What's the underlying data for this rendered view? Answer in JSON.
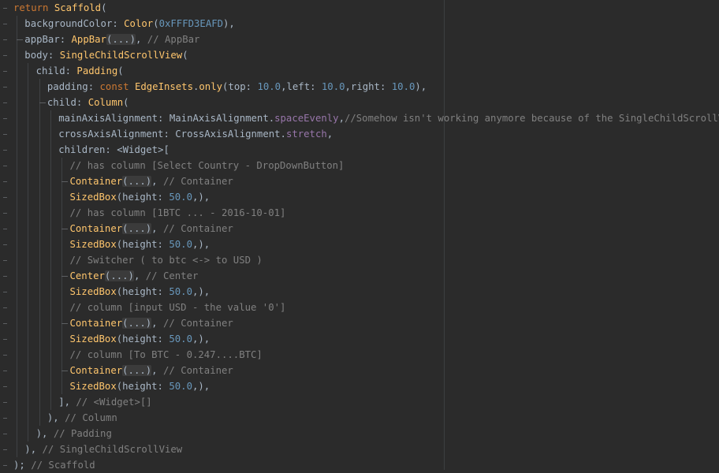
{
  "editor": {
    "lines": [
      {
        "indent": 1,
        "tokens": [
          {
            "t": "return ",
            "c": "kw"
          },
          {
            "t": "Scaffold",
            "c": "cls"
          },
          {
            "t": "(",
            "c": "plain"
          }
        ]
      },
      {
        "indent": 2,
        "tokens": [
          {
            "t": "backgroundColor: ",
            "c": "plain"
          },
          {
            "t": "Color",
            "c": "cls"
          },
          {
            "t": "(",
            "c": "plain"
          },
          {
            "t": "0xFFFD3EAFD",
            "c": "num"
          },
          {
            "t": "),",
            "c": "plain"
          }
        ]
      },
      {
        "indent": 2,
        "branch": true,
        "tokens": [
          {
            "t": "appBar: ",
            "c": "plain"
          },
          {
            "t": "AppBar",
            "c": "cls"
          },
          {
            "t": "(...)",
            "c": "fold"
          },
          {
            "t": ", ",
            "c": "plain"
          },
          {
            "t": "// AppBar",
            "c": "cmt"
          }
        ]
      },
      {
        "indent": 2,
        "tokens": [
          {
            "t": "body: ",
            "c": "plain"
          },
          {
            "t": "SingleChildScrollView",
            "c": "cls"
          },
          {
            "t": "(",
            "c": "plain"
          }
        ]
      },
      {
        "indent": 3,
        "tokens": [
          {
            "t": "child: ",
            "c": "plain"
          },
          {
            "t": "Padding",
            "c": "cls"
          },
          {
            "t": "(",
            "c": "plain"
          }
        ]
      },
      {
        "indent": 4,
        "tokens": [
          {
            "t": "padding: ",
            "c": "plain"
          },
          {
            "t": "const ",
            "c": "kw"
          },
          {
            "t": "EdgeInsets",
            "c": "cls"
          },
          {
            "t": ".",
            "c": "plain"
          },
          {
            "t": "only",
            "c": "fn"
          },
          {
            "t": "(top: ",
            "c": "plain"
          },
          {
            "t": "10.0",
            "c": "num"
          },
          {
            "t": ",left: ",
            "c": "plain"
          },
          {
            "t": "10.0",
            "c": "num"
          },
          {
            "t": ",right: ",
            "c": "plain"
          },
          {
            "t": "10.0",
            "c": "num"
          },
          {
            "t": "),",
            "c": "plain"
          }
        ]
      },
      {
        "indent": 4,
        "branch": true,
        "tokens": [
          {
            "t": "child: ",
            "c": "plain"
          },
          {
            "t": "Column",
            "c": "cls"
          },
          {
            "t": "(",
            "c": "plain"
          }
        ]
      },
      {
        "indent": 5,
        "tokens": [
          {
            "t": "mainAxisAlignment: ",
            "c": "plain"
          },
          {
            "t": "MainAxisAlignment",
            "c": "plain"
          },
          {
            "t": ".",
            "c": "plain"
          },
          {
            "t": "spaceEvenly",
            "c": "prop"
          },
          {
            "t": ",",
            "c": "plain"
          },
          {
            "t": "//Somehow isn't working anymore because of the SingleChildScrollView",
            "c": "cmt"
          }
        ]
      },
      {
        "indent": 5,
        "tokens": [
          {
            "t": "crossAxisAlignment: ",
            "c": "plain"
          },
          {
            "t": "CrossAxisAlignment",
            "c": "plain"
          },
          {
            "t": ".",
            "c": "plain"
          },
          {
            "t": "stretch",
            "c": "prop"
          },
          {
            "t": ",",
            "c": "plain"
          }
        ]
      },
      {
        "indent": 5,
        "tokens": [
          {
            "t": "children: ",
            "c": "plain"
          },
          {
            "t": "<Widget>[",
            "c": "plain"
          }
        ]
      },
      {
        "indent": 6,
        "tokens": [
          {
            "t": "// has column [Select Country - DropDownButton]",
            "c": "cmt"
          }
        ]
      },
      {
        "indent": 6,
        "branch": true,
        "tokens": [
          {
            "t": "Container",
            "c": "cls"
          },
          {
            "t": "(...)",
            "c": "fold"
          },
          {
            "t": ", ",
            "c": "plain"
          },
          {
            "t": "// Container",
            "c": "cmt"
          }
        ]
      },
      {
        "indent": 6,
        "tokens": [
          {
            "t": "SizedBox",
            "c": "cls"
          },
          {
            "t": "(height: ",
            "c": "plain"
          },
          {
            "t": "50.0",
            "c": "num"
          },
          {
            "t": ",),",
            "c": "plain"
          }
        ]
      },
      {
        "indent": 6,
        "tokens": [
          {
            "t": "// has column [1BTC ... - 2016-10-01]",
            "c": "cmt"
          }
        ]
      },
      {
        "indent": 6,
        "branch": true,
        "tokens": [
          {
            "t": "Container",
            "c": "cls"
          },
          {
            "t": "(...)",
            "c": "fold"
          },
          {
            "t": ", ",
            "c": "plain"
          },
          {
            "t": "// Container",
            "c": "cmt"
          }
        ]
      },
      {
        "indent": 6,
        "tokens": [
          {
            "t": "SizedBox",
            "c": "cls"
          },
          {
            "t": "(height: ",
            "c": "plain"
          },
          {
            "t": "50.0",
            "c": "num"
          },
          {
            "t": ",),",
            "c": "plain"
          }
        ]
      },
      {
        "indent": 6,
        "tokens": [
          {
            "t": "// Switcher ( to btc <-> to USD )",
            "c": "cmt"
          }
        ]
      },
      {
        "indent": 6,
        "branch": true,
        "tokens": [
          {
            "t": "Center",
            "c": "cls"
          },
          {
            "t": "(...)",
            "c": "fold"
          },
          {
            "t": ", ",
            "c": "plain"
          },
          {
            "t": "// Center",
            "c": "cmt"
          }
        ]
      },
      {
        "indent": 6,
        "tokens": [
          {
            "t": "SizedBox",
            "c": "cls"
          },
          {
            "t": "(height: ",
            "c": "plain"
          },
          {
            "t": "50.0",
            "c": "num"
          },
          {
            "t": ",),",
            "c": "plain"
          }
        ]
      },
      {
        "indent": 6,
        "tokens": [
          {
            "t": "// column [input USD - the value '0']",
            "c": "cmt"
          }
        ]
      },
      {
        "indent": 6,
        "branch": true,
        "tokens": [
          {
            "t": "Container",
            "c": "cls"
          },
          {
            "t": "(...)",
            "c": "fold"
          },
          {
            "t": ", ",
            "c": "plain"
          },
          {
            "t": "// Container",
            "c": "cmt"
          }
        ]
      },
      {
        "indent": 6,
        "tokens": [
          {
            "t": "SizedBox",
            "c": "cls"
          },
          {
            "t": "(height: ",
            "c": "plain"
          },
          {
            "t": "50.0",
            "c": "num"
          },
          {
            "t": ",),",
            "c": "plain"
          }
        ]
      },
      {
        "indent": 6,
        "tokens": [
          {
            "t": "// column [To BTC - 0.247....BTC]",
            "c": "cmt"
          }
        ]
      },
      {
        "indent": 6,
        "branch": true,
        "tokens": [
          {
            "t": "Container",
            "c": "cls"
          },
          {
            "t": "(...)",
            "c": "fold"
          },
          {
            "t": ", ",
            "c": "plain"
          },
          {
            "t": "// Container",
            "c": "cmt"
          }
        ]
      },
      {
        "indent": 6,
        "tokens": [
          {
            "t": "SizedBox",
            "c": "cls"
          },
          {
            "t": "(height: ",
            "c": "plain"
          },
          {
            "t": "50.0",
            "c": "num"
          },
          {
            "t": ",),",
            "c": "plain"
          }
        ]
      },
      {
        "indent": 5,
        "tokens": [
          {
            "t": "], ",
            "c": "plain"
          },
          {
            "t": "// <Widget>[]",
            "c": "cmt"
          }
        ]
      },
      {
        "indent": 4,
        "tokens": [
          {
            "t": "), ",
            "c": "plain"
          },
          {
            "t": "// Column",
            "c": "cmt"
          }
        ]
      },
      {
        "indent": 3,
        "tokens": [
          {
            "t": "), ",
            "c": "plain"
          },
          {
            "t": "// Padding",
            "c": "cmt"
          }
        ]
      },
      {
        "indent": 2,
        "tokens": [
          {
            "t": "), ",
            "c": "plain"
          },
          {
            "t": "// SingleChildScrollView",
            "c": "cmt"
          }
        ]
      },
      {
        "indent": 1,
        "tokens": [
          {
            "t": "); ",
            "c": "plain"
          },
          {
            "t": "// Scaffold",
            "c": "cmt"
          }
        ]
      }
    ]
  },
  "colors": {
    "background": "#2b2b2b",
    "keyword": "#cc7832",
    "class": "#ffc66d",
    "number": "#6897bb",
    "property": "#9876aa",
    "comment": "#808080",
    "text": "#a9b7c6"
  }
}
